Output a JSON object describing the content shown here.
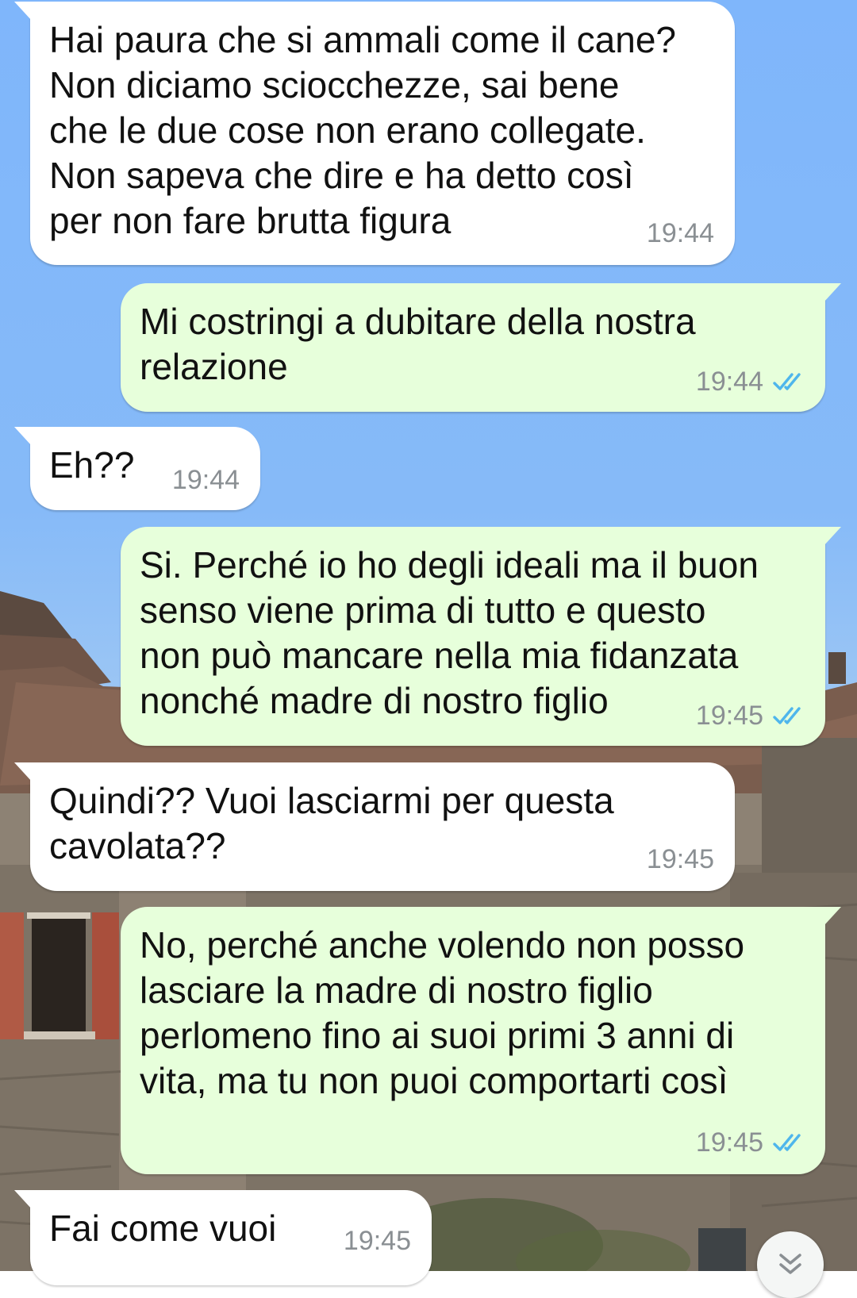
{
  "messages": [
    {
      "direction": "incoming",
      "lines": [
        "Hai paura che si ammali come il cane?",
        "Non diciamo sciocchezze, sai bene",
        "che le due cose non erano collegate.",
        "Non sapeva che dire e ha detto così",
        "per non fare brutta figura"
      ],
      "time": "19:44"
    },
    {
      "direction": "outgoing",
      "lines": [
        "Mi costringi a dubitare della nostra",
        "relazione"
      ],
      "time": "19:44",
      "status": "read"
    },
    {
      "direction": "incoming",
      "lines": [
        "Eh??"
      ],
      "time": "19:44"
    },
    {
      "direction": "outgoing",
      "lines": [
        "Si. Perché io ho degli ideali ma il buon",
        "senso viene prima di tutto e questo",
        "non può mancare nella mia fidanzata",
        "nonché madre di nostro figlio"
      ],
      "time": "19:45",
      "status": "read"
    },
    {
      "direction": "incoming",
      "lines": [
        "Quindi?? Vuoi lasciarmi per questa",
        "cavolata??"
      ],
      "time": "19:45"
    },
    {
      "direction": "outgoing",
      "lines": [
        "No, perché anche volendo non posso",
        "lasciare la madre di nostro figlio",
        "perlomeno fino ai suoi primi 3 anni di",
        "vita, ma tu non puoi comportarti così"
      ],
      "time": "19:45",
      "status": "read"
    },
    {
      "direction": "incoming",
      "lines": [
        "Fai come vuoi"
      ],
      "time": "19:45"
    }
  ],
  "icons": {
    "read_receipt": "double-check-icon",
    "scroll_down": "chevron-double-down-icon"
  },
  "colors": {
    "incoming_bubble": "#ffffff",
    "outgoing_bubble": "#e7ffdb",
    "read_tick": "#4fb6ec",
    "timestamp": "#8a8f93",
    "sky": "#7fb6fb"
  }
}
